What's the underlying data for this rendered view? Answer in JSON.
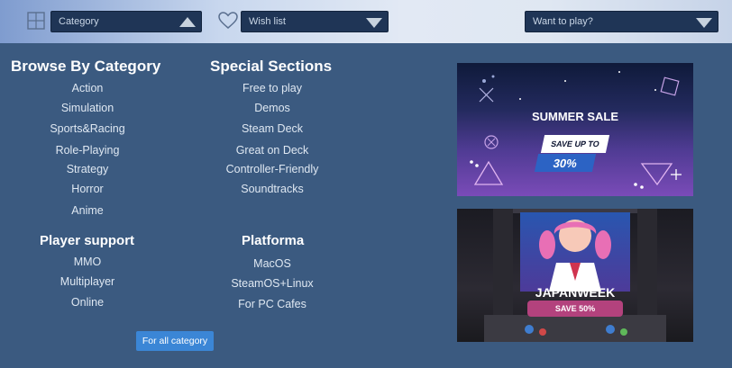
{
  "topbar": {
    "category_select": {
      "value": "Category"
    },
    "wishlist_select": {
      "value": "Wish list"
    },
    "want_select": {
      "value": "Want to play?"
    }
  },
  "browse": {
    "title": "Browse By Category",
    "items": [
      "Action",
      "Simulation",
      "Sports&Racing",
      "Role-Playing",
      "Strategy",
      "Horror",
      "Anime"
    ]
  },
  "special": {
    "title": "Special Sections",
    "items": [
      "Free to play",
      "Demos",
      "Steam Deck",
      "Great on Deck",
      "Controller-Friendly",
      "Soundtracks"
    ]
  },
  "support": {
    "title": "Player support",
    "items": [
      "MMO",
      "Multiplayer",
      "Online"
    ]
  },
  "platforma": {
    "title": "Platforma",
    "items": [
      "MacOS",
      "SteamOS+Linux",
      "For PC Cafes"
    ]
  },
  "all_button": "For all category",
  "banner_summer": {
    "title": "SUMMER SALE",
    "save_up": "SAVE UP TO",
    "percent": "30%"
  },
  "banner_japan": {
    "title": "JAPANWEEK",
    "save": "SAVE 50%"
  },
  "colors": {
    "page_bg": "#3b5a80",
    "dropdown_bg": "#1f3556",
    "button_bg": "#3b86d6"
  }
}
